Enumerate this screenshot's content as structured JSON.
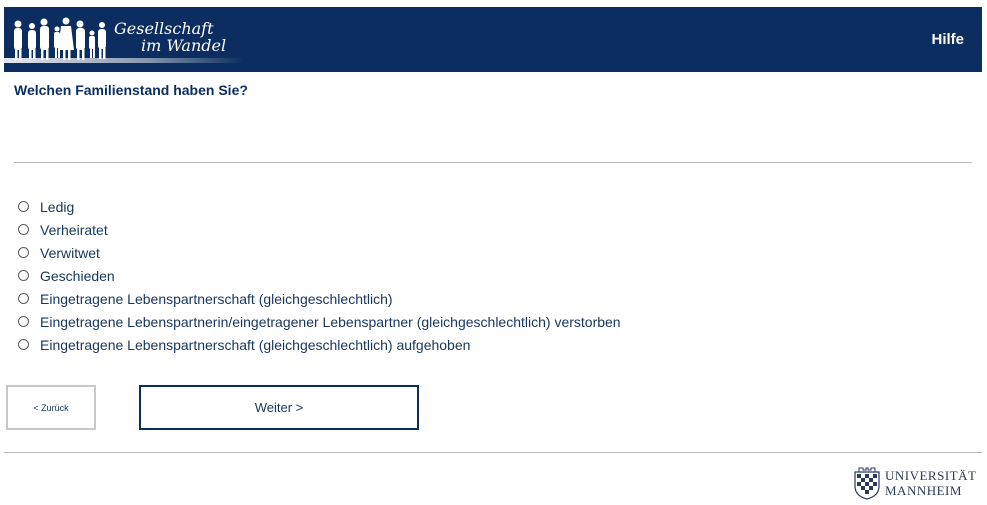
{
  "header": {
    "logo_line1": "Gesellschaft",
    "logo_line2": "im Wandel",
    "help_label": "Hilfe"
  },
  "question": "Welchen Familienstand haben Sie?",
  "options": [
    "Ledig",
    "Verheiratet",
    "Verwitwet",
    "Geschieden",
    "Eingetragene Lebenspartnerschaft (gleichgeschlechtlich)",
    "Eingetragene Lebenspartnerin/eingetragener Lebenspartner (gleichgeschlechtlich) verstorben",
    "Eingetragene Lebenspartnerschaft (gleichgeschlechtlich) aufgehoben"
  ],
  "nav": {
    "back_label": "< Zurück",
    "next_label": "Weiter >"
  },
  "footer": {
    "uni_line1": "UNIVERSITÄT",
    "uni_line2": "MANNHEIM"
  },
  "colors": {
    "header_bg": "#0b2d5f",
    "text": "#17365d"
  }
}
